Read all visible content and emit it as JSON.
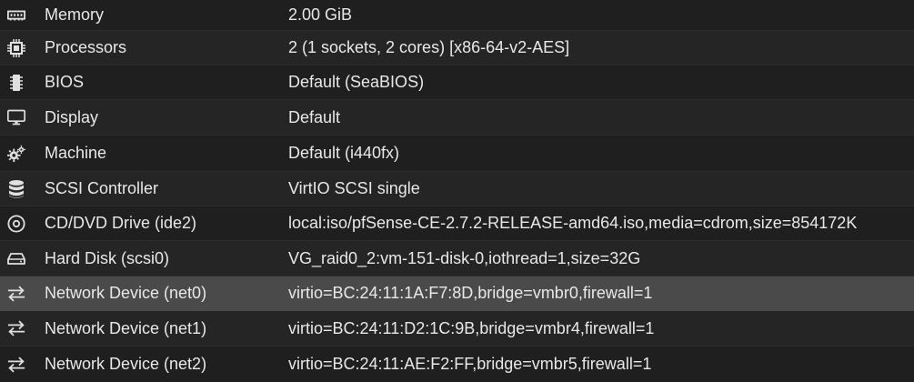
{
  "hardware": {
    "rows": [
      {
        "icon": "memory-icon",
        "key": "Memory",
        "value": "2.00 GiB"
      },
      {
        "icon": "processor-icon",
        "key": "Processors",
        "value": "2 (1 sockets, 2 cores) [x86-64-v2-AES]"
      },
      {
        "icon": "bios-chip-icon",
        "key": "BIOS",
        "value": "Default (SeaBIOS)"
      },
      {
        "icon": "display-monitor-icon",
        "key": "Display",
        "value": "Default"
      },
      {
        "icon": "machine-gears-icon",
        "key": "Machine",
        "value": "Default (i440fx)"
      },
      {
        "icon": "database-icon",
        "key": "SCSI Controller",
        "value": "VirtIO SCSI single"
      },
      {
        "icon": "cdrom-icon",
        "key": "CD/DVD Drive (ide2)",
        "value": "local:iso/pfSense-CE-2.7.2-RELEASE-amd64.iso,media=cdrom,size=854172K"
      },
      {
        "icon": "hard-disk-icon",
        "key": "Hard Disk (scsi0)",
        "value": "VG_raid0_2:vm-151-disk-0,iothread=1,size=32G"
      },
      {
        "icon": "network-exchange-icon",
        "key": "Network Device (net0)",
        "value": "virtio=BC:24:11:1A:F7:8D,bridge=vmbr0,firewall=1",
        "selected": true
      },
      {
        "icon": "network-exchange-icon",
        "key": "Network Device (net1)",
        "value": "virtio=BC:24:11:D2:1C:9B,bridge=vmbr4,firewall=1"
      },
      {
        "icon": "network-exchange-icon",
        "key": "Network Device (net2)",
        "value": "virtio=BC:24:11:AE:F2:FF,bridge=vmbr5,firewall=1"
      }
    ]
  }
}
